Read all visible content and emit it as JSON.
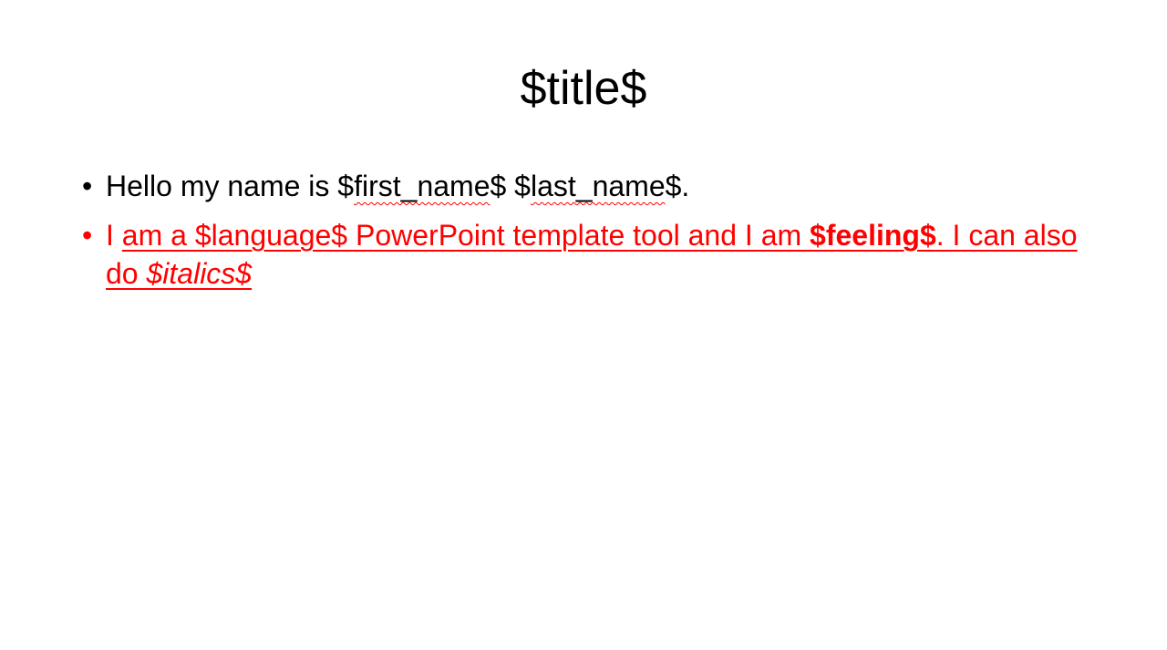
{
  "slide": {
    "title": "$title$",
    "bullet1": {
      "before": "Hello my name is $",
      "first_name": "first_name",
      "middle": "$ $",
      "last_name": "last_name",
      "after": "$."
    },
    "bullet2": {
      "lead": "I ",
      "underlined_start": "am a $language$ PowerPoint template tool and I am ",
      "feeling": "$feeling$",
      "underlined_mid": ". I can also do ",
      "italics": "$italics$"
    },
    "colors": {
      "text": "#000000",
      "accent": "#ff0000",
      "background": "#ffffff"
    }
  }
}
